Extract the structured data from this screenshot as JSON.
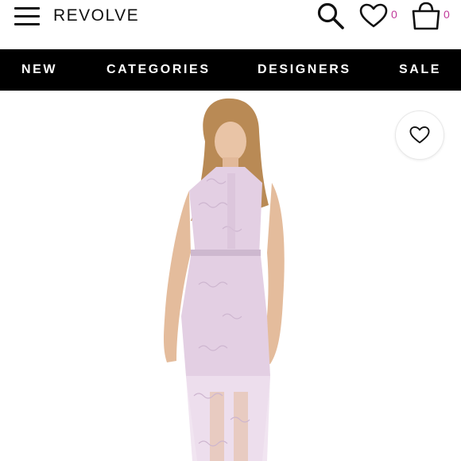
{
  "header": {
    "brand": "REVOLVE",
    "wishlist_count": "0",
    "bag_count": "0",
    "icons": [
      "menu-icon",
      "search-icon",
      "heart-icon",
      "shopping-bag-icon"
    ]
  },
  "nav": {
    "items": [
      {
        "label": "NEW"
      },
      {
        "label": "CATEGORIES"
      },
      {
        "label": "DESIGNERS"
      },
      {
        "label": "SALE"
      }
    ]
  },
  "product": {
    "favorite_icon": "heart-icon"
  },
  "colors": {
    "nav_background": "#000000",
    "badge_count": "#c0399a",
    "dress": "#e3cfe3",
    "page_background": "#ffffff"
  }
}
